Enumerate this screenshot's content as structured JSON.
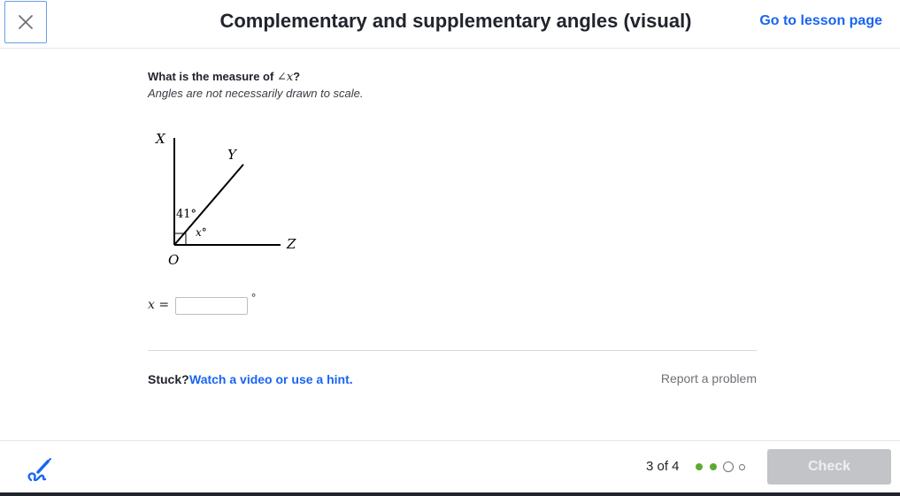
{
  "header": {
    "close_icon": "close-icon",
    "title": "Complementary and supplementary angles (visual)",
    "lesson_link": "Go to lesson page"
  },
  "question": {
    "prefix": "What is the measure of ",
    "math": "∠x",
    "suffix": "?",
    "note": "Angles are not necessarily drawn to scale."
  },
  "diagram": {
    "point_x": "X",
    "point_y": "Y",
    "point_z": "Z",
    "point_o": "O",
    "angle_xoy": "41°",
    "angle_yoz": "x°",
    "right_angle_marker": true
  },
  "answer": {
    "label": "x =",
    "value": "",
    "placeholder": "",
    "unit": "°"
  },
  "help": {
    "stuck": "Stuck?",
    "hint_link": "Watch a video or use a hint.",
    "report_link": "Report a problem"
  },
  "footer": {
    "scratchpad_icon": "pencil-scribble-icon",
    "progress": "3 of 4",
    "dots": [
      "complete",
      "complete",
      "current",
      "upcoming"
    ],
    "check_label": "Check",
    "colors": {
      "complete": "#5cac31",
      "accent_blue": "#1865f2",
      "disabled_button": "#c3c4c7"
    }
  }
}
